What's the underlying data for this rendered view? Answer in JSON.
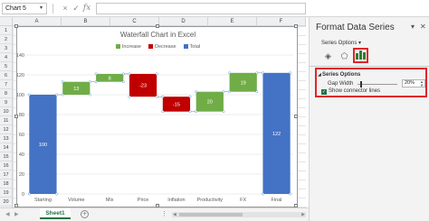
{
  "formula_bar": {
    "name_box": "Chart 5",
    "cancel_icon": "×",
    "enter_icon": "✓",
    "fx_label": "fx",
    "formula": ""
  },
  "columns": [
    "A",
    "B",
    "C",
    "D",
    "E",
    "F",
    "G"
  ],
  "rows": [
    "1",
    "2",
    "3",
    "4",
    "5",
    "6",
    "7",
    "8",
    "9",
    "10",
    "11",
    "12",
    "13",
    "14",
    "15",
    "16",
    "17",
    "18",
    "19",
    "20"
  ],
  "chart": {
    "title": "Waterfall Chart in Excel",
    "legend": [
      {
        "label": "Increase",
        "color": "#70ad47"
      },
      {
        "label": "Decrease",
        "color": "#c00000"
      },
      {
        "label": "Total",
        "color": "#4472c4"
      }
    ]
  },
  "chart_data": {
    "type": "bar",
    "subtype": "waterfall",
    "title": "Waterfall Chart in Excel",
    "categories": [
      "Starting",
      "Volume",
      "Mix",
      "Price",
      "Inflation",
      "Productivity",
      "FX",
      "Final"
    ],
    "bars": [
      {
        "category": "Starting",
        "kind": "Total",
        "from": 0,
        "to": 100,
        "label": "100"
      },
      {
        "category": "Volume",
        "kind": "Increase",
        "from": 100,
        "to": 113,
        "label": "13"
      },
      {
        "category": "Mix",
        "kind": "Increase",
        "from": 113,
        "to": 121,
        "label": "8"
      },
      {
        "category": "Price",
        "kind": "Decrease",
        "from": 121,
        "to": 98,
        "label": "-23"
      },
      {
        "category": "Inflation",
        "kind": "Decrease",
        "from": 98,
        "to": 83,
        "label": "-15"
      },
      {
        "category": "Productivity",
        "kind": "Increase",
        "from": 83,
        "to": 103,
        "label": "20"
      },
      {
        "category": "FX",
        "kind": "Increase",
        "from": 103,
        "to": 122,
        "label": "19"
      },
      {
        "category": "Final",
        "kind": "Total",
        "from": 0,
        "to": 122,
        "label": "122"
      }
    ],
    "ylim": [
      0,
      140
    ],
    "yticks": [
      "0",
      "20",
      "40",
      "60",
      "80",
      "100",
      "120",
      "140"
    ],
    "grid": true,
    "legend_position": "top",
    "colors": {
      "Increase": "#70ad47",
      "Decrease": "#c00000",
      "Total": "#4472c4"
    }
  },
  "format_panel": {
    "title": "Format Data Series",
    "menu_label": "Series Options",
    "tabs": [
      {
        "name": "fill-line-icon",
        "glyph": "◈"
      },
      {
        "name": "effects-icon",
        "glyph": "⬠"
      },
      {
        "name": "series-options-icon",
        "glyph": "▮▮▮"
      }
    ],
    "section_title": "Series Options",
    "gap_width_label": "Gap Width",
    "gap_width_value": "20%",
    "gap_width_fraction": 0.2,
    "show_connector_lines_label": "Show connector lines",
    "show_connector_lines_checked": true
  },
  "sheet_tabs": {
    "active": "Sheet1",
    "add_label": "+"
  }
}
